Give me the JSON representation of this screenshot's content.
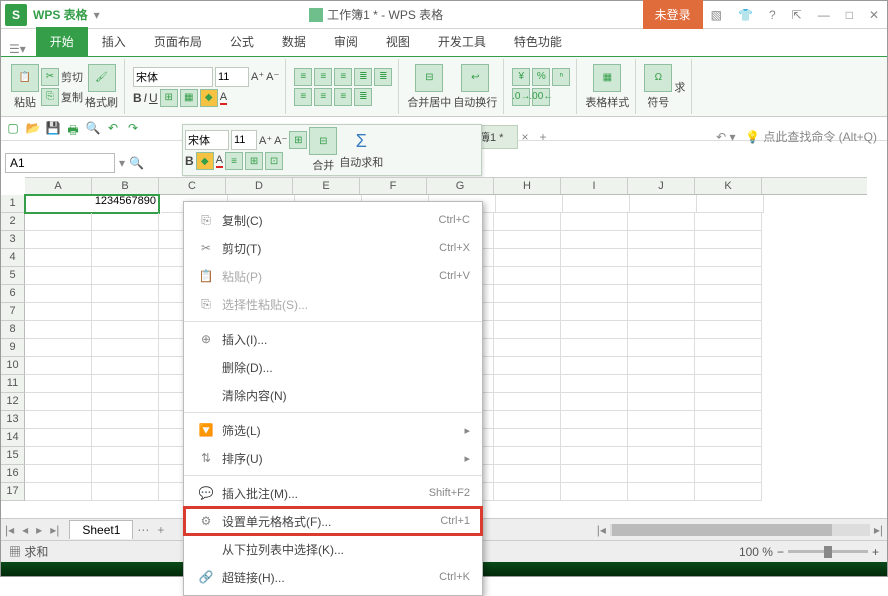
{
  "titlebar": {
    "app": "WPS 表格",
    "doc": "工作簿1 * - WPS 表格",
    "login": "未登录"
  },
  "menu": {
    "start": "开始",
    "insert": "插入",
    "layout": "页面布局",
    "formula": "公式",
    "data": "数据",
    "review": "审阅",
    "view": "视图",
    "dev": "开发工具",
    "feature": "特色功能"
  },
  "ribbon": {
    "paste": "粘贴",
    "cut": "剪切",
    "copy": "复制",
    "format_painter": "格式刷",
    "font": "宋体",
    "font_size": "11",
    "merge_center": "合并居中",
    "wrap": "自动换行",
    "table_style": "表格样式",
    "symbol": "符号",
    "sum": "求",
    "float_merge": "合并",
    "float_sum": "自动求和"
  },
  "mini_tab": {
    "doc_name": "工作簿1 *"
  },
  "namebox": {
    "cell": "A1"
  },
  "columns": [
    "A",
    "B",
    "C",
    "D",
    "E",
    "F",
    "G",
    "H",
    "I",
    "J",
    "K"
  ],
  "rows": [
    "1",
    "2",
    "3",
    "4",
    "5",
    "6",
    "7",
    "8",
    "9",
    "10",
    "11",
    "12",
    "13",
    "14",
    "15",
    "16",
    "17"
  ],
  "cell_value": "1234567890",
  "sheet": {
    "name": "Sheet1",
    "dots": "⋯",
    "plus": "+"
  },
  "status": {
    "sum_label": "求和",
    "zoom": "100 %"
  },
  "help_hint": "点此查找命令 (Alt+Q)",
  "ctx": {
    "copy": "复制(C)",
    "copy_s": "Ctrl+C",
    "cut": "剪切(T)",
    "cut_s": "Ctrl+X",
    "paste": "粘贴(P)",
    "paste_s": "Ctrl+V",
    "paste_special": "选择性粘贴(S)...",
    "insert": "插入(I)...",
    "delete": "删除(D)...",
    "clear": "清除内容(N)",
    "filter": "筛选(L)",
    "sort": "排序(U)",
    "comment": "插入批注(M)...",
    "comment_s": "Shift+F2",
    "cell_format": "设置单元格格式(F)...",
    "cell_format_s": "Ctrl+1",
    "dropdown": "从下拉列表中选择(K)...",
    "hyperlink": "超链接(H)...",
    "hyperlink_s": "Ctrl+K"
  }
}
